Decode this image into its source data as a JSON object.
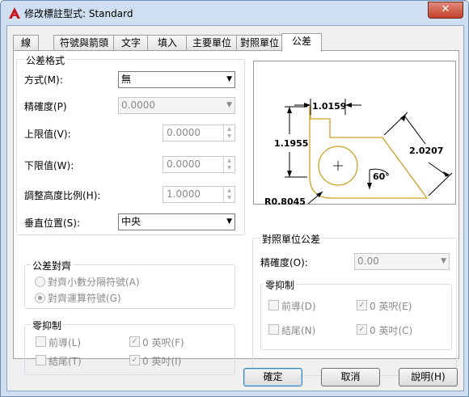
{
  "window": {
    "title": "修改標註型式: Standard",
    "close_label": "✕",
    "app_icon": "autocad-icon"
  },
  "tabs": [
    "線",
    "符號與箭頭",
    "文字",
    "填入",
    "主要單位",
    "對照單位",
    "公差"
  ],
  "active_tab": "公差",
  "tolerance_format": {
    "title": "公差格式",
    "method_label": "方式(M):",
    "method_value": "無",
    "precision_label": "精確度(P)",
    "precision_value": "0.0000",
    "upper_label": "上限值(V):",
    "upper_value": "0.0000",
    "lower_label": "下限值(W):",
    "lower_value": "0.0000",
    "scale_label": "調整高度比例(H):",
    "scale_value": "1.0000",
    "vpos_label": "垂直位置(S):",
    "vpos_value": "中央"
  },
  "tolerance_align": {
    "title": "公差對齊",
    "opt1": "對齊小數分隔符號(A)",
    "opt2": "對齊運算符號(G)",
    "selected": 2
  },
  "zero_suppress_left": {
    "title": "零抑制",
    "leading": "前導(L)",
    "trailing": "結尾(T)",
    "feet": "0 英呎(F)",
    "inches": "0 英吋(I)",
    "feet_checked": true,
    "inches_checked": true
  },
  "preview": {
    "dim_top": "1.0159",
    "dim_left": "1.1955",
    "dim_right": "2.0207",
    "dim_angle": "60°",
    "dim_radius": "R0.8045",
    "shape_color": "#c9a227"
  },
  "alt_tolerance": {
    "title": "對照單位公差",
    "precision_label": "精確度(O):",
    "precision_value": "0.00",
    "zero_title": "零抑制",
    "leading": "前導(D)",
    "trailing": "結尾(N)",
    "feet": "0 英呎(E)",
    "inches": "0 英吋(C)",
    "feet_checked": true,
    "inches_checked": true
  },
  "buttons": {
    "ok": "確定",
    "cancel": "取消",
    "help": "說明(H)"
  }
}
